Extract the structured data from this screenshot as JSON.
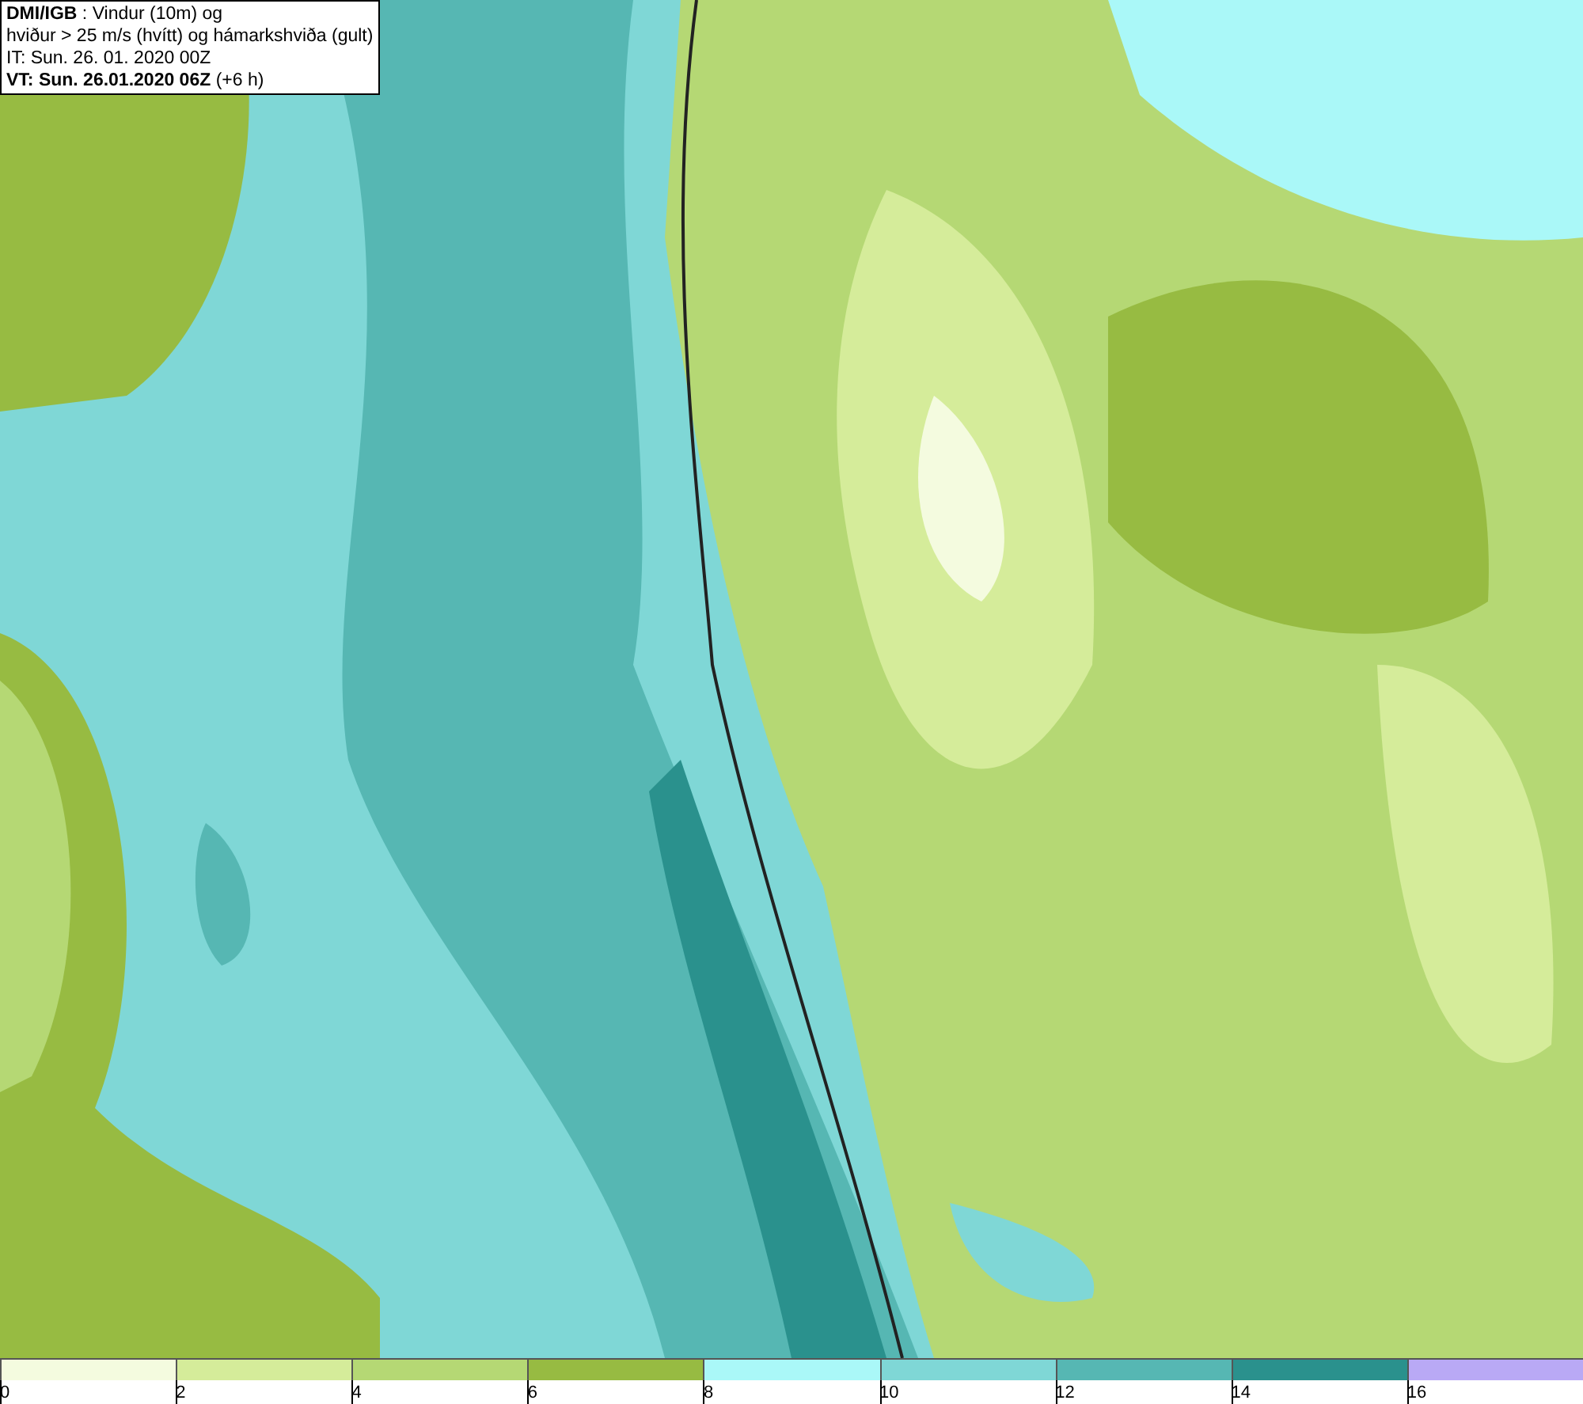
{
  "title_box": {
    "lines": [
      "**DMI/IGB** : Vindur (10m) og",
      "hviður > 25 m/s (hvítt) og hámarkshviða (gult)",
      "IT: Sun. 26. 01. 2020 00Z",
      "**VT: Sun. 26.01.2020 06Z** (+6 h)"
    ]
  },
  "legend": {
    "segments": [
      {
        "label": "0",
        "color": "#f4fbdf"
      },
      {
        "label": "2",
        "color": "#d5ec9a"
      },
      {
        "label": "4",
        "color": "#b5d874"
      },
      {
        "label": "6",
        "color": "#97bb42"
      },
      {
        "label": "8",
        "color": "#aaf8f8"
      },
      {
        "label": "10",
        "color": "#7fd7d6"
      },
      {
        "label": "12",
        "color": "#56b7b3"
      },
      {
        "label": "14",
        "color": "#2a918d"
      },
      {
        "label": "16",
        "color": "#b9a9f5"
      }
    ]
  }
}
